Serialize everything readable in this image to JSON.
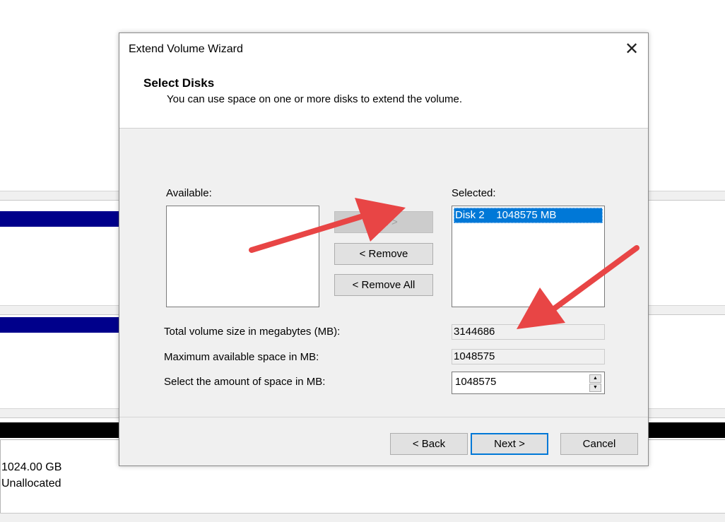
{
  "background": {
    "unallocated_size": "1024.00 GB",
    "unallocated_label": "Unallocated"
  },
  "dialog": {
    "title": "Extend Volume Wizard",
    "close_glyph": "✕",
    "heading": "Select Disks",
    "description": "You can use space on one or more disks to extend the volume.",
    "available_label": "Available:",
    "selected_label": "Selected:",
    "available_items": [],
    "selected_items": [
      "Disk 2    1048575 MB"
    ],
    "add_button": "Add >",
    "remove_button": "< Remove",
    "remove_all_button": "< Remove All",
    "total_size_label": "Total volume size in megabytes (MB):",
    "total_size_value": "3144686",
    "max_space_label": "Maximum available space in MB:",
    "max_space_value": "1048575",
    "select_amount_label": "Select the amount of space in MB:",
    "select_amount_value": "1048575",
    "back_button": "< Back",
    "next_button": "Next >",
    "cancel_button": "Cancel"
  },
  "colors": {
    "selection": "#0078d7",
    "arrow": "#e84545",
    "volume_bar": "#00008b"
  },
  "icons": {
    "close": "close-icon",
    "spin_up": "spin-up-icon",
    "spin_down": "spin-down-icon"
  }
}
